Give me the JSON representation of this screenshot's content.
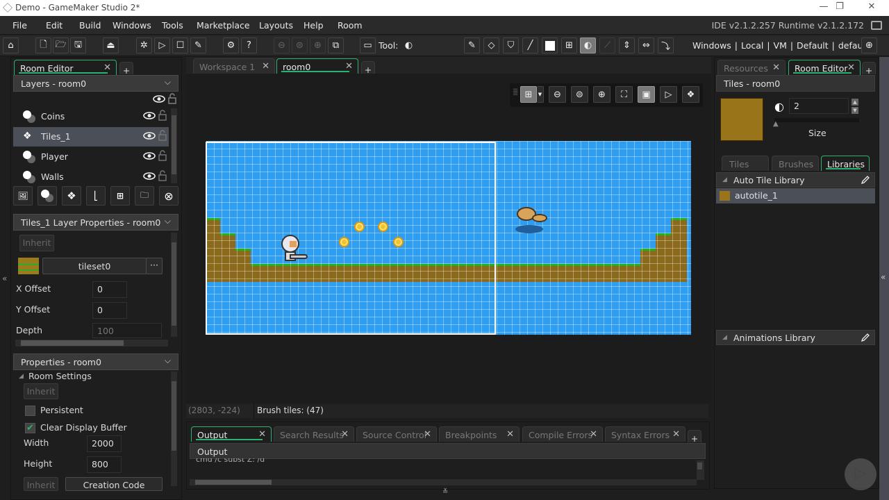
{
  "window": {
    "title": "Demo - GameMaker Studio 2*",
    "controls": [
      "minimize",
      "restore",
      "close"
    ]
  },
  "menu": {
    "items": [
      "File",
      "Edit",
      "Build",
      "Windows",
      "Tools",
      "Marketplace",
      "Layouts",
      "Help",
      "Room"
    ],
    "version": "IDE v2.1.2.257 Runtime v2.1.2.172"
  },
  "toolbar": {
    "tool_label": "Tool:",
    "target": "Windows | Local | VM | Default | default",
    "left_icons": [
      "home-icon",
      "new-file-icon",
      "open-folder-icon",
      "save-icon",
      "export-icon",
      "debug-icon",
      "run-icon",
      "stop-icon",
      "clean-icon",
      "settings-icon",
      "help-icon",
      "zoom-out-icon",
      "zoom-reset-icon",
      "zoom-in-icon",
      "gamepad-icon",
      "monitor-icon"
    ],
    "tool_icons": [
      "pencil-icon",
      "eraser-icon",
      "fill-icon",
      "line-icon",
      "rectangle-icon",
      "select-icon",
      "autotile-icon",
      "brush-disabled-icon",
      "flip-vertical-icon",
      "flip-horizontal-icon",
      "rotate-icon"
    ]
  },
  "left_dock": {
    "tabs": [
      {
        "label": "Room Editor",
        "active": true
      }
    ],
    "add_tab": "+",
    "layers": {
      "header": "Layers - room0",
      "items": [
        {
          "name": "Coins",
          "type": "instance",
          "selected": false
        },
        {
          "name": "Tiles_1",
          "type": "tile",
          "selected": true
        },
        {
          "name": "Player",
          "type": "instance",
          "selected": false
        },
        {
          "name": "Walls",
          "type": "instance",
          "selected": false
        }
      ],
      "buttons": [
        "add-background-layer",
        "add-instance-layer",
        "add-tile-layer",
        "add-path-layer",
        "add-asset-layer",
        "add-folder",
        "delete-layer"
      ]
    },
    "layer_properties": {
      "header": "Tiles_1 Layer Properties - room0",
      "inherit": "Inherit",
      "tileset": "tileset0",
      "tileset_more": "···",
      "fields": [
        {
          "label": "X Offset",
          "value": "0"
        },
        {
          "label": "Y Offset",
          "value": "0"
        },
        {
          "label": "Depth",
          "value": "100"
        }
      ]
    },
    "room_properties": {
      "header": "Properties - room0",
      "section": "Room Settings",
      "inherit": "Inherit",
      "persistent": {
        "label": "Persistent",
        "checked": false
      },
      "clear_display": {
        "label": "Clear Display Buffer",
        "checked": true
      },
      "width": {
        "label": "Width",
        "value": "2000"
      },
      "height": {
        "label": "Height",
        "value": "800"
      },
      "inherit2": "Inherit",
      "creation_code": "Creation Code"
    },
    "collapse": "«"
  },
  "center": {
    "tabs": [
      {
        "label": "Workspace 1",
        "active": false
      },
      {
        "label": "room0",
        "active": true
      }
    ],
    "add_tab": "+",
    "canvas_toolbar": [
      "grid-icon",
      "zoom-out-icon",
      "zoom-reset-icon",
      "zoom-in-icon",
      "fit-icon",
      "view-icon",
      "play-icon",
      "layers-icon"
    ],
    "status": {
      "coords": "(2803, -224)",
      "info": "Brush tiles: (47)"
    }
  },
  "output": {
    "tabs": [
      {
        "label": "Output",
        "active": true
      },
      {
        "label": "Search Results",
        "active": false
      },
      {
        "label": "Source Control",
        "active": false
      },
      {
        "label": "Breakpoints",
        "active": false
      },
      {
        "label": "Compile Errors",
        "active": false
      },
      {
        "label": "Syntax Errors",
        "active": false
      }
    ],
    "add_tab": "+",
    "header": "Output",
    "text": "cmd  /c subst Z: /d"
  },
  "right_dock": {
    "tabs": [
      {
        "label": "Resources",
        "active": false
      },
      {
        "label": "Room Editor",
        "active": true
      }
    ],
    "add_tab": "+",
    "tiles_header": "Tiles - room0",
    "brush_size": "2",
    "size_label": "Size",
    "size_slider": 0,
    "swatch_color": "#9a7418",
    "subtabs": [
      {
        "label": "Tiles",
        "active": false
      },
      {
        "label": "Brushes",
        "active": false
      },
      {
        "label": "Libraries",
        "active": true
      }
    ],
    "auto_tile_library": {
      "label": "Auto Tile Library",
      "items": [
        "autotile_1"
      ]
    },
    "animations_library": {
      "label": "Animations Library"
    }
  },
  "colors": {
    "accent": "#2db36f",
    "sky": "#2f9ef0",
    "ground": "#8b6a1c",
    "grass": "#1fb322",
    "coin": "#f2c32b"
  }
}
